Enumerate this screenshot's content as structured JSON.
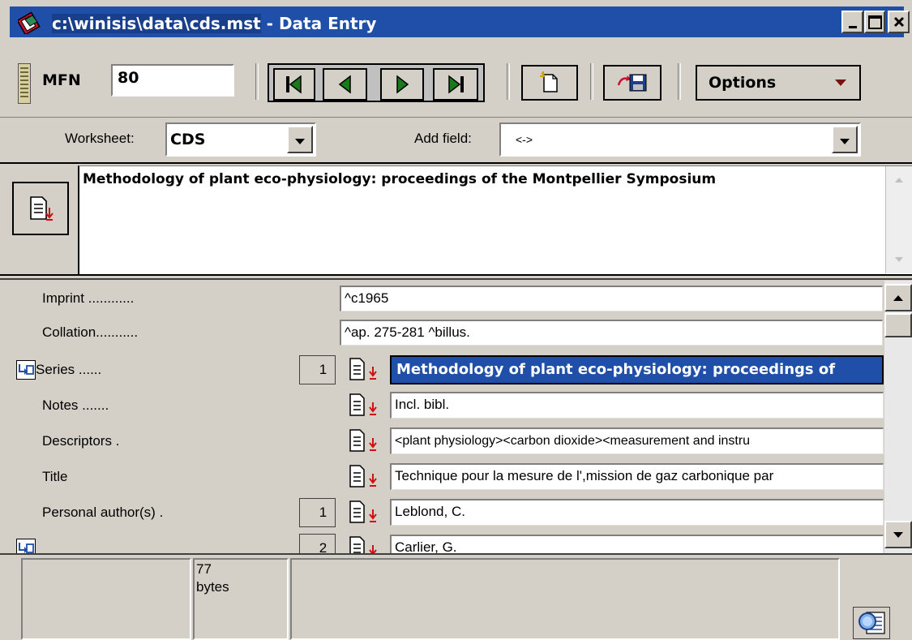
{
  "window": {
    "path": "c:\\winisis\\data\\cds.mst",
    "title_sep": " - ",
    "mode": "Data Entry",
    "titlebar_color": "#1f4fa8"
  },
  "toolbar": {
    "mfn_label": "MFN",
    "mfn_value": "80",
    "options_label": "Options"
  },
  "worksheet": {
    "label": "Worksheet:",
    "value": "CDS",
    "add_field_label": "Add field:",
    "add_field_value": "<->"
  },
  "preview": {
    "text": "Methodology of plant eco-physiology: proceedings of the Montpellier Symposium"
  },
  "fields": [
    {
      "label": "Imprint ............",
      "value": "^c1965"
    },
    {
      "label": "Collation...........",
      "value": "^ap. 275-281 ^billus."
    },
    {
      "label": "Series ......",
      "occ": "1",
      "value": "Methodology of plant eco-physiology: proceedings of"
    },
    {
      "label": "Notes .......",
      "value": "Incl. bibl."
    },
    {
      "label": "Descriptors .",
      "value": "<plant physiology><carbon dioxide><measurement and instru"
    },
    {
      "label": "Title",
      "value": "Technique pour la mesure de l',mission de gaz carbonique par"
    },
    {
      "label": "Personal author(s) .",
      "occ": "1",
      "value": "Leblond, C."
    },
    {
      "label": "",
      "occ": "2",
      "value": "Carlier, G."
    }
  ],
  "status": {
    "size_value": "77",
    "size_unit": "bytes"
  },
  "icons": {
    "app": "app-icon",
    "first": "first-record-icon",
    "prev": "previous-record-icon",
    "next": "next-record-icon",
    "last": "last-record-icon",
    "new": "new-record-icon",
    "save": "save-record-icon",
    "search": "search-icon"
  }
}
